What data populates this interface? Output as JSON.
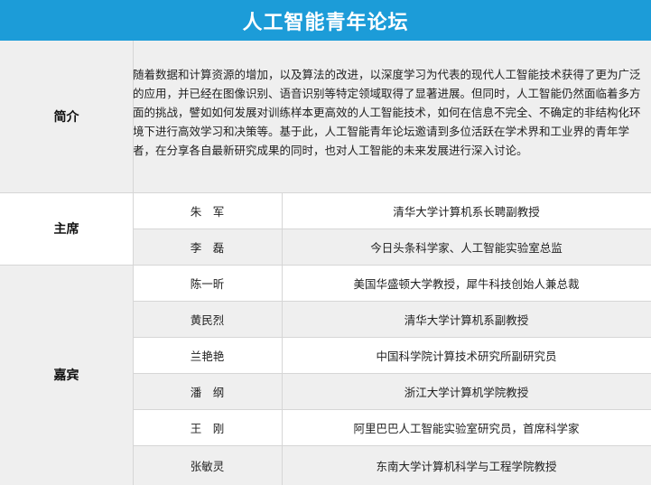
{
  "title": "人工智能青年论坛",
  "intro": {
    "label": "简介",
    "text": "随着数据和计算资源的增加，以及算法的改进，以深度学习为代表的现代人工智能技术获得了更为广泛的应用，并已经在图像识别、语音识别等特定领域取得了显著进展。但同时，人工智能仍然面临着多方面的挑战，譬如如何发展对训练样本更高效的人工智能技术，如何在信息不完全、不确定的非结构化环境下进行高效学习和决策等。基于此，人工智能青年论坛邀请到多位活跃在学术界和工业界的青年学者，在分享各自最新研究成果的同时，也对人工智能的未来发展进行深入讨论。"
  },
  "chairs": {
    "label": "主席",
    "people": [
      {
        "name": "朱　军",
        "title": "清华大学计算机系长聘副教授"
      },
      {
        "name": "李　磊",
        "title": "今日头条科学家、人工智能实验室总监"
      }
    ]
  },
  "guests": {
    "label": "嘉宾",
    "people": [
      {
        "name": "陈一昕",
        "title": "美国华盛顿大学教授，犀牛科技创始人兼总裁"
      },
      {
        "name": "黄民烈",
        "title": "清华大学计算机系副教授"
      },
      {
        "name": "兰艳艳",
        "title": "中国科学院计算技术研究所副研究员"
      },
      {
        "name": "潘　纲",
        "title": "浙江大学计算机学院教授"
      },
      {
        "name": "王　刚",
        "title": "阿里巴巴人工智能实验室研究员，首席科学家"
      },
      {
        "name": "张敏灵",
        "title": "东南大学计算机科学与工程学院教授"
      }
    ]
  }
}
